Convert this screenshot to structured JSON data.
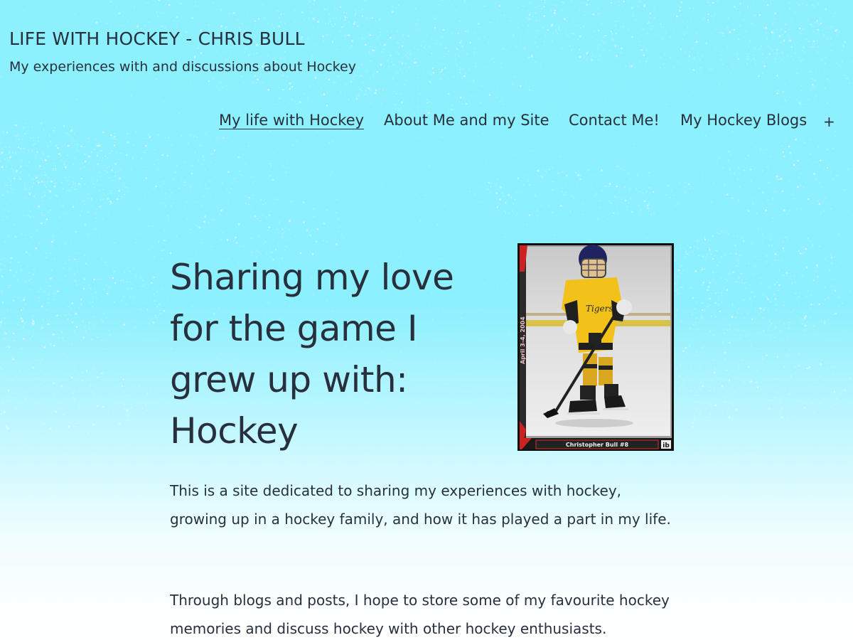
{
  "site": {
    "title": "LIFE WITH HOCKEY - CHRIS BULL",
    "tagline": "My experiences with and discussions about Hockey"
  },
  "nav": {
    "items": [
      {
        "label": "My life with Hockey",
        "current": true
      },
      {
        "label": "About Me and my Site",
        "current": false
      },
      {
        "label": "Contact Me!",
        "current": false
      },
      {
        "label": "My Hockey Blogs",
        "current": false
      }
    ],
    "expand_label": "+",
    "expand_icon": "plus-icon"
  },
  "hero": {
    "title": "Sharing my love for the game I grew up with: Hockey",
    "photo": {
      "caption": "Christopher Bull #8",
      "date_stamp": "April 3-4, 2004",
      "corner_mark": "ib"
    }
  },
  "body": {
    "paragraphs": [
      "This is a site dedicated to sharing my experiences with hockey, growing up in a hockey family, and how it has played a part in my life.",
      "Through blogs and posts, I hope to store some of my favourite hockey memories and discuss hockey with other hockey enthusiasts."
    ]
  },
  "colors": {
    "background_top": "#8cf0fd",
    "background_bottom": "#ffffff",
    "text": "#28303d",
    "snow": "#ffffff",
    "jersey": "#f2c21b",
    "helmet": "#1f2460"
  }
}
